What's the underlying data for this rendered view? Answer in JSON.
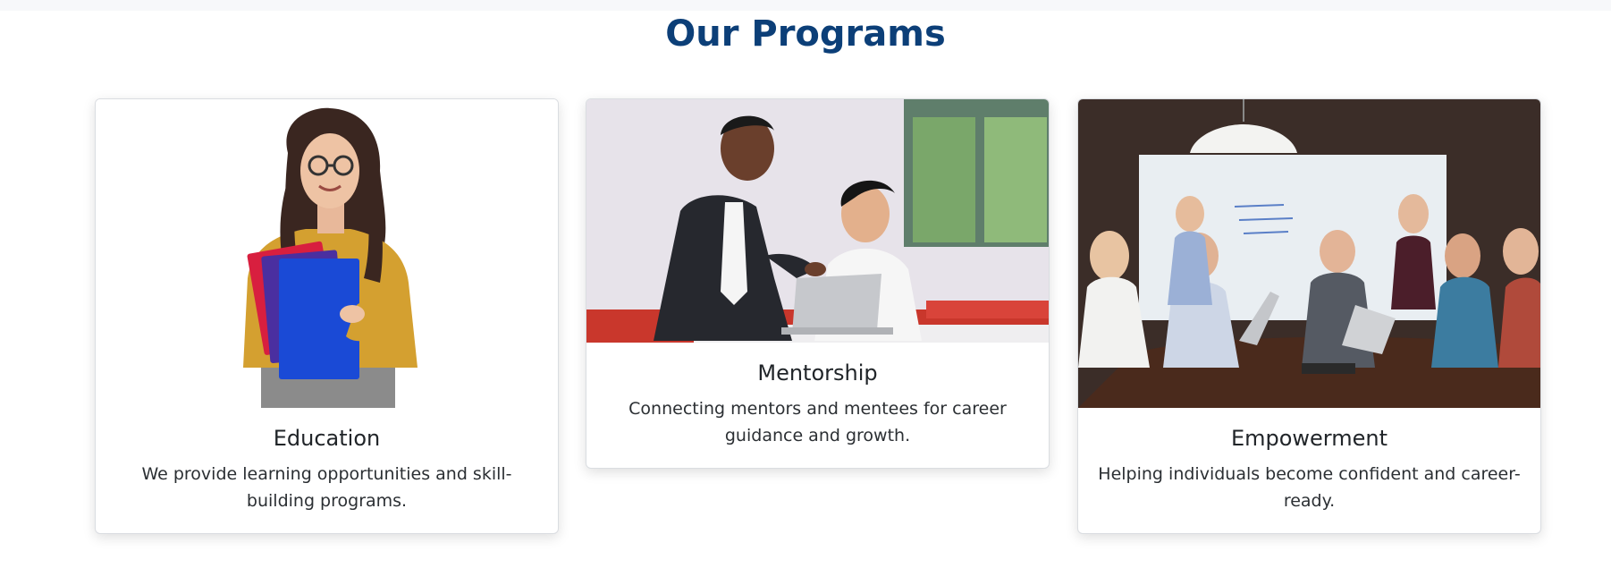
{
  "section": {
    "title": "Our Programs"
  },
  "programs": [
    {
      "title": "Education",
      "description": "We provide learning opportunities and skill-building programs.",
      "image": "student-holding-books-photo"
    },
    {
      "title": "Mentorship",
      "description": "Connecting mentors and mentees for career guidance and growth.",
      "image": "mentor-and-student-with-laptop-photo"
    },
    {
      "title": "Empowerment",
      "description": "Helping individuals become confident and career-ready.",
      "image": "team-meeting-conference-room-photo"
    }
  ],
  "colors": {
    "title": "#0c3f78",
    "card_border": "#dadde1",
    "text": "#212529"
  }
}
